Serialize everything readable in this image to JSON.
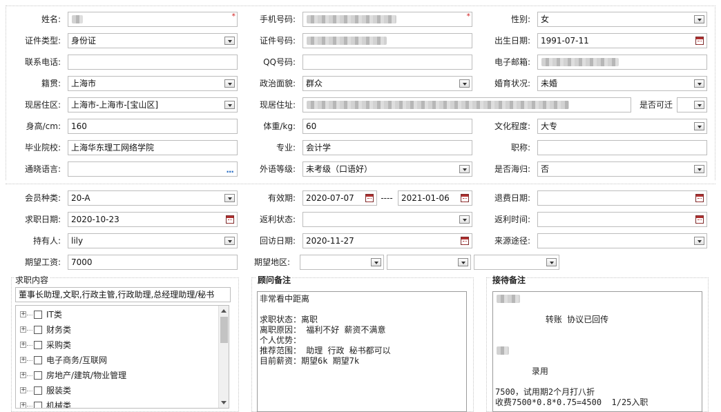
{
  "personal": {
    "name": {
      "label": "姓名:",
      "value": "",
      "required_mark": "*"
    },
    "phone": {
      "label": "手机号码:",
      "value": "",
      "required_mark": "*"
    },
    "gender": {
      "label": "性别:",
      "value": "女"
    },
    "id_type": {
      "label": "证件类型:",
      "value": "身份证"
    },
    "id_number": {
      "label": "证件号码:",
      "value": ""
    },
    "birth_date": {
      "label": "出生日期:",
      "value": "1991-07-11"
    },
    "contact_phone": {
      "label": "联系电话:",
      "value": ""
    },
    "qq": {
      "label": "QQ号码:",
      "value": ""
    },
    "email": {
      "label": "电子邮箱:",
      "value": ""
    },
    "native_place": {
      "label": "籍贯:",
      "value": "上海市"
    },
    "political": {
      "label": "政治面貌:",
      "value": "群众"
    },
    "marital": {
      "label": "婚育状况:",
      "value": "未婚"
    },
    "residence_area": {
      "label": "现居住区:",
      "value": "上海市-上海市-[宝山区]"
    },
    "address": {
      "label": "现居住址:",
      "value": ""
    },
    "available": {
      "label": "是否可迁",
      "value": ""
    },
    "height": {
      "label": "身高/cm:",
      "value": "160"
    },
    "weight": {
      "label": "体重/kg:",
      "value": "60"
    },
    "education": {
      "label": "文化程度:",
      "value": "大专"
    },
    "school": {
      "label": "毕业院校:",
      "value": "上海华东理工网络学院"
    },
    "major": {
      "label": "专业:",
      "value": "会计学"
    },
    "title": {
      "label": "职称:",
      "value": ""
    },
    "language": {
      "label": "通晓语言:",
      "value": "",
      "more": "..."
    },
    "foreign_level": {
      "label": "外语等级:",
      "value": "未考级（口语好）"
    },
    "returnee": {
      "label": "是否海归:",
      "value": "否"
    }
  },
  "membership": {
    "member_type": {
      "label": "会员种类:",
      "value": "20-A"
    },
    "validity": {
      "label": "有效期:",
      "start": "2020-07-07",
      "sep": "----",
      "end": "2021-01-06"
    },
    "refund_date": {
      "label": "退费日期:",
      "value": ""
    },
    "job_date": {
      "label": "求职日期:",
      "value": "2020-10-23"
    },
    "rebate_status": {
      "label": "返利状态:",
      "value": ""
    },
    "rebate_time": {
      "label": "返利时间:",
      "value": ""
    },
    "holder": {
      "label": "持有人:",
      "value": "lily"
    },
    "visit_date": {
      "label": "回访日期:",
      "value": "2020-11-27"
    },
    "source": {
      "label": "来源途径:",
      "value": ""
    },
    "salary": {
      "label": "期望工资:",
      "value": "7000"
    },
    "region": {
      "label": "期望地区:",
      "values": [
        "",
        "",
        ""
      ]
    }
  },
  "job_section": {
    "title": "求职内容",
    "summary": "董事长助理,文职,行政主管,行政助理,总经理助理/秘书",
    "tree": [
      "IT类",
      "财务类",
      "采购类",
      "电子商务/互联网",
      "房地产/建筑/物业管理",
      "服装类",
      "机械类"
    ]
  },
  "consultant_notes": {
    "title": "顾问备注",
    "lines": [
      "非常看中距离",
      "",
      "求职状态：离职",
      "离职原因： 福利不好 薪资不满意",
      "个人优势：",
      "推荐范围： 助理 行政 秘书都可以",
      "目前薪资：期望6k 期望7k"
    ]
  },
  "reception_notes": {
    "title": "接待备注",
    "lines": [
      "转账 协议已回传",
      "",
      "录用",
      "7500，试用期2个月打八折",
      "收费7500*0.8*0.75=4500  1/25入职"
    ]
  }
}
